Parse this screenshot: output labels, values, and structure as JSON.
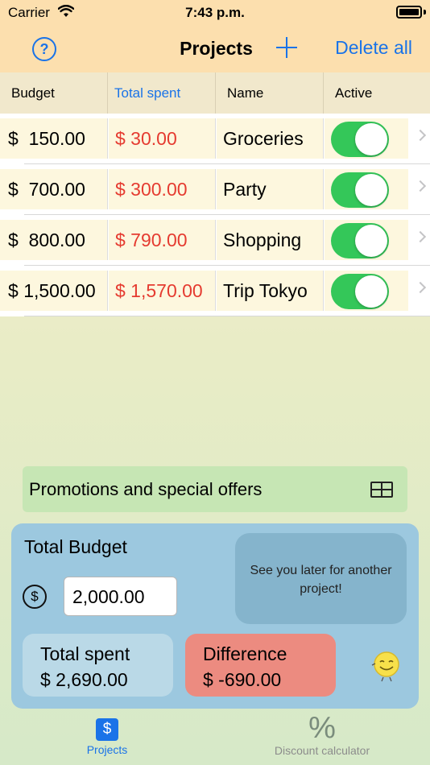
{
  "status_bar": {
    "carrier": "Carrier",
    "time": "7:43 p.m."
  },
  "nav": {
    "help_icon": "question-circle-icon",
    "help_label": "?",
    "title": "Projects",
    "add_icon": "plus-icon",
    "delete_all": "Delete all"
  },
  "columns": {
    "budget": "Budget",
    "total_spent": "Total spent",
    "name": "Name",
    "active": "Active"
  },
  "projects": [
    {
      "currency": "$",
      "budget": "150.00",
      "spent": "$ 30.00",
      "name": "Groceries",
      "active": true
    },
    {
      "currency": "$",
      "budget": "700.00",
      "spent": "$ 300.00",
      "name": "Party",
      "active": true
    },
    {
      "currency": "$",
      "budget": "800.00",
      "spent": "$ 790.00",
      "name": "Shopping",
      "active": true
    },
    {
      "currency": "$",
      "budget": "1,500.00",
      "spent": "$ 1,570.00",
      "name": "Trip Tokyo",
      "active": true
    }
  ],
  "promo": {
    "label": "Promotions and special offers",
    "icon": "gift-card-icon"
  },
  "summary": {
    "total_budget_label": "Total Budget",
    "currency_icon": "dollar-circle-icon",
    "currency_symbol": "$",
    "total_budget_value": "2,000.00",
    "message": "See you later for another project!",
    "total_spent_label": "Total spent",
    "total_spent_value": "$ 2,690.00",
    "difference_label": "Difference",
    "difference_value": "$ -690.00",
    "mascot_icon": "smiley-coin-icon"
  },
  "tabs": [
    {
      "label": "Projects",
      "icon": "dollar-square-icon",
      "glyph": "$",
      "selected": true
    },
    {
      "label": "Discount calculator",
      "icon": "percent-icon",
      "glyph": "%",
      "selected": false
    }
  ],
  "colors": {
    "accent": "#1a73e8",
    "spent_red": "#e53b30",
    "toggle_on": "#34c759",
    "header_bg": "#fcdfae",
    "summary_bg": "#9cc8df",
    "difference_bg": "#ec8b80",
    "promo_bg": "#c6e6b4"
  }
}
